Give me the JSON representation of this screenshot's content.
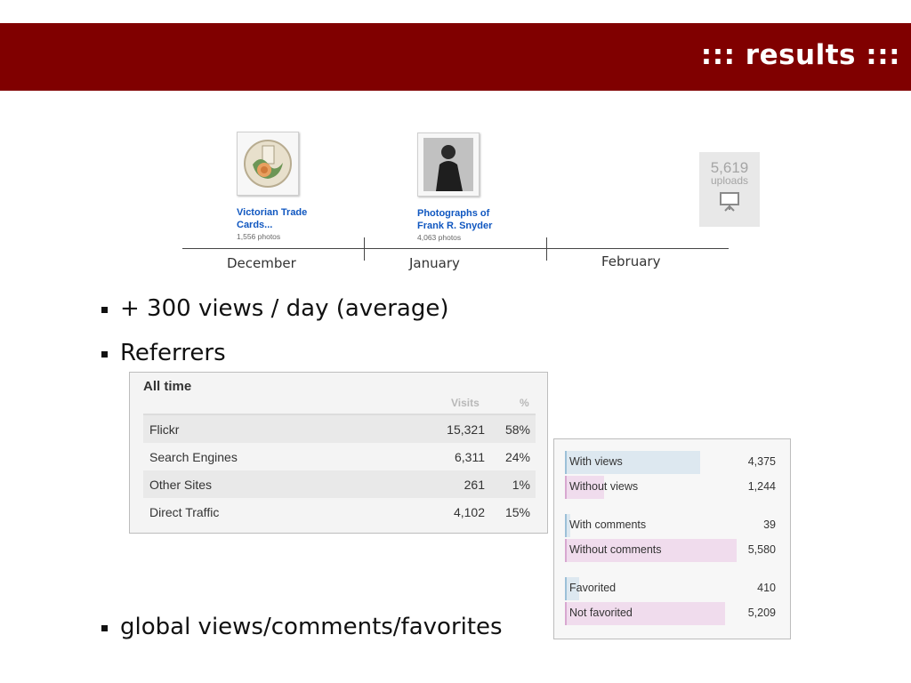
{
  "header": {
    "title": "::: results :::"
  },
  "timeline": {
    "months": [
      "December",
      "January",
      "February"
    ],
    "sets": [
      {
        "title_line1": "Victorian Trade",
        "title_line2": "Cards...",
        "count": "1,556 photos"
      },
      {
        "title_line1": "Photographs of",
        "title_line2": "Frank R. Snyder",
        "count": "4,063 photos"
      }
    ],
    "uploads": {
      "number": "5,619",
      "label": "uploads"
    }
  },
  "bullets": {
    "views": "+ 300 views / day (average)",
    "referrers": "Referrers",
    "global": "global views/comments/favorites"
  },
  "referrers": {
    "title": "All time",
    "col_visits": "Visits",
    "col_pct": "%",
    "rows": [
      {
        "name": "Flickr",
        "visits": "15,321",
        "pct": "58%"
      },
      {
        "name": "Search Engines",
        "visits": "6,311",
        "pct": "24%"
      },
      {
        "name": "Other Sites",
        "visits": "261",
        "pct": "1%"
      },
      {
        "name": "Direct Traffic",
        "visits": "4,102",
        "pct": "15%"
      }
    ]
  },
  "global_stats": {
    "rows": [
      {
        "label": "With views",
        "value": "4,375",
        "fraction": 0.78,
        "color": "blue"
      },
      {
        "label": "Without views",
        "value": "1,244",
        "fraction": 0.22,
        "color": "pink"
      },
      {
        "label": "With comments",
        "value": "39",
        "fraction": 0.007,
        "color": "blue"
      },
      {
        "label": "Without comments",
        "value": "5,580",
        "fraction": 0.993,
        "color": "pink"
      },
      {
        "label": "Favorited",
        "value": "410",
        "fraction": 0.073,
        "color": "blue"
      },
      {
        "label": "Not favorited",
        "value": "5,209",
        "fraction": 0.927,
        "color": "pink"
      }
    ]
  },
  "colors": {
    "header_bg": "#800000",
    "link": "#1057c0",
    "bar_blue": "#dde8f0",
    "bar_pink": "#f0dced"
  }
}
